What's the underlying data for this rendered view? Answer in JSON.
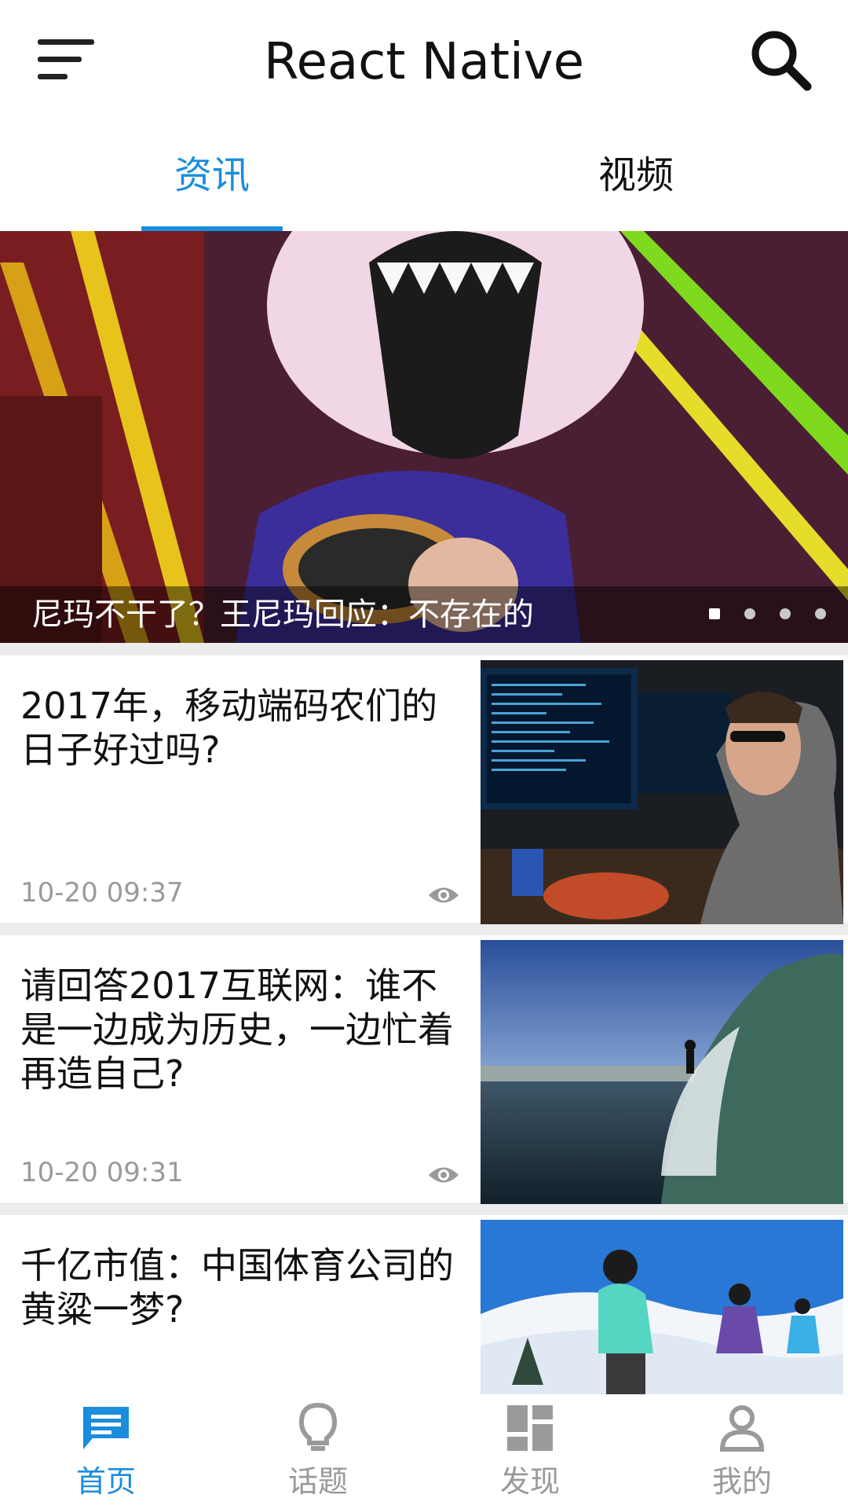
{
  "header": {
    "title": "React Native",
    "menu_icon": "sort-menu-icon",
    "search_icon": "search-icon"
  },
  "tabs": [
    {
      "label": "资讯",
      "active": true
    },
    {
      "label": "视频",
      "active": false
    }
  ],
  "banner": {
    "caption": "尼玛不干了？王尼玛回应：不存在的",
    "slides_total": 4,
    "active_slide": 1
  },
  "news": [
    {
      "title": "2017年，移动端码农们的日子好过吗?",
      "time": "10-20 09:37"
    },
    {
      "title": "请回答2017互联网：谁不是一边成为历史，一边忙着再造自己?",
      "time": "10-20 09:31"
    },
    {
      "title": "千亿市值：中国体育公司的黄粱一梦?",
      "time": ""
    }
  ],
  "bottom_nav": [
    {
      "label": "首页",
      "icon": "message-icon",
      "active": true
    },
    {
      "label": "话题",
      "icon": "lightbulb-icon",
      "active": false
    },
    {
      "label": "发现",
      "icon": "dashboard-icon",
      "active": false
    },
    {
      "label": "我的",
      "icon": "person-icon",
      "active": false
    }
  ],
  "colors": {
    "accent": "#1a8ddc",
    "muted": "#9a9a9a",
    "separator": "#ececec"
  }
}
